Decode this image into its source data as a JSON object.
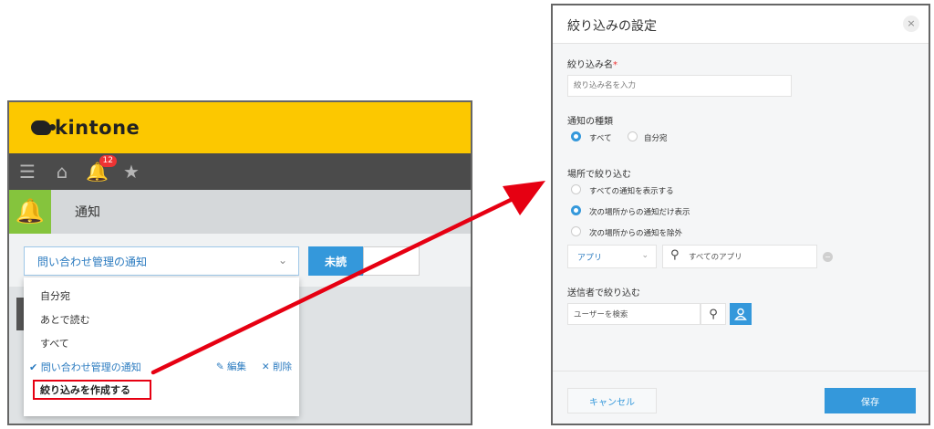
{
  "app": {
    "logo_text": "kintone",
    "notification_count": "12",
    "page_title": "通知",
    "filter_select_value": "問い合わせ管理の通知",
    "unread_button": "未読",
    "dropdown": {
      "items": [
        "自分宛",
        "あとで読む",
        "すべて"
      ],
      "active_item": "問い合わせ管理の通知",
      "edit_label": "編集",
      "delete_label": "削除",
      "create_label": "絞り込みを作成する"
    }
  },
  "dialog": {
    "title": "絞り込みの設定",
    "close_glyph": "×",
    "name_label": "絞り込み名",
    "required_mark": "*",
    "name_placeholder": "絞り込み名を入力",
    "type_label": "通知の種類",
    "type_options": [
      {
        "label": "すべて",
        "checked": true
      },
      {
        "label": "自分宛",
        "checked": false
      }
    ],
    "location_label": "場所で絞り込む",
    "location_options": [
      {
        "label": "すべての通知を表示する",
        "checked": false
      },
      {
        "label": "次の場所からの通知だけ表示",
        "checked": true
      },
      {
        "label": "次の場所からの通知を除外",
        "checked": false
      }
    ],
    "app_select_value": "アプリ",
    "app_search_value": "すべてのアプリ",
    "sender_label": "送信者で絞り込む",
    "user_placeholder": "ユーザーを検索",
    "cancel_label": "キャンセル",
    "save_label": "保存"
  },
  "colors": {
    "brand_yellow": "#fcc800",
    "accent_blue": "#3498db",
    "highlight_red": "#e60012"
  }
}
